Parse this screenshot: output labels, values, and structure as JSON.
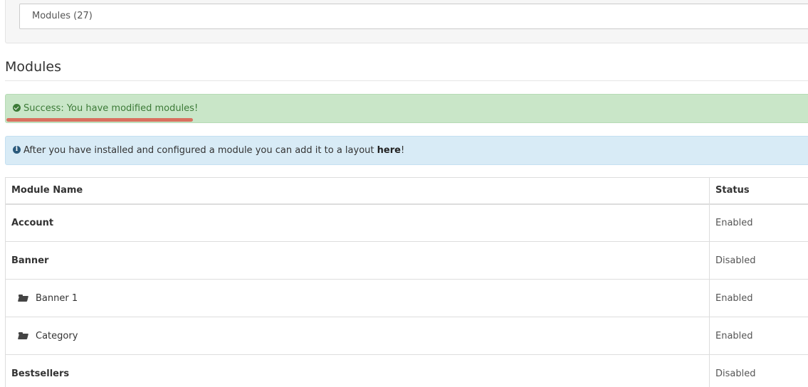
{
  "filter": {
    "selected": "Modules (27)"
  },
  "heading": {
    "title": "Modules"
  },
  "alerts": {
    "success": {
      "text": "Success: You have modified modules!"
    },
    "info": {
      "text_before": "After you have installed and configured a module you can add it to a layout ",
      "link": "here",
      "text_after": "!"
    }
  },
  "table": {
    "headers": {
      "name": "Module Name",
      "status": "Status"
    },
    "rows": [
      {
        "name": "Account",
        "status": "Enabled",
        "child": false
      },
      {
        "name": "Banner",
        "status": "Disabled",
        "child": false
      },
      {
        "name": "Banner 1",
        "status": "Enabled",
        "child": true,
        "icon": "folder-open-icon"
      },
      {
        "name": "Category",
        "status": "Enabled",
        "child": true,
        "icon": "folder-open-icon"
      },
      {
        "name": "Bestsellers",
        "status": "Disabled",
        "child": false
      }
    ]
  },
  "colors": {
    "success_bg": "#c9e6c8",
    "success_text": "#3c7a37",
    "info_bg": "#d8ebf6",
    "highlight": "#d9705f"
  }
}
